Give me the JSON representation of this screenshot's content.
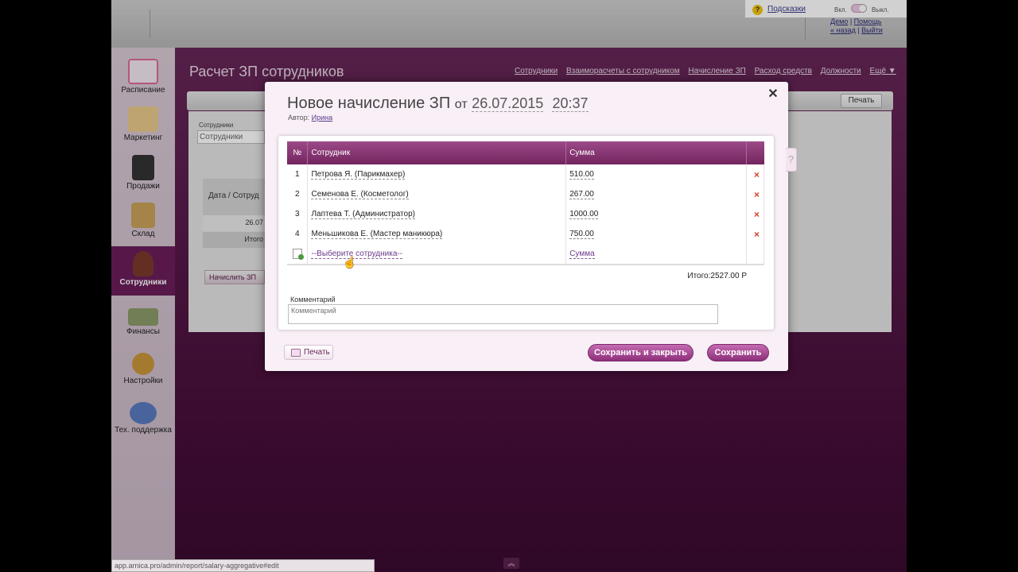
{
  "topbar": {
    "hints": {
      "label": "Подсказки",
      "on": "Вкл.",
      "off": "Выкл."
    },
    "user_links": {
      "demo": "Демо",
      "sep": "|",
      "help": "Помощь",
      "back": "« назад",
      "logout": "Выйти"
    }
  },
  "sidebar": {
    "items": [
      {
        "label": "Расписание",
        "color": "#d96a9a"
      },
      {
        "label": "Маркетинг",
        "color": "#d8a25a"
      },
      {
        "label": "Продажи",
        "color": "#4a4a4a"
      },
      {
        "label": "Склад",
        "color": "#c09a4a"
      },
      {
        "label": "Сотрудники",
        "color": "#7a3a2a"
      },
      {
        "label": "Финансы",
        "color": "#7a8a5a"
      },
      {
        "label": "Настройки",
        "color": "#b98a3a"
      },
      {
        "label": "Тех. поддержка",
        "color": "#4a6ab0"
      }
    ]
  },
  "page": {
    "title": "Расчет ЗП сотрудников",
    "nav": [
      "Сотрудники",
      "Взаиморасчеты с сотрудником",
      "Начисление ЗП",
      "Расход средств",
      "Должности",
      "Ещё ▼"
    ],
    "print": "Печать",
    "filter_label": "Сотрудники",
    "filter_value": "Сотрудники",
    "table_header": "Дата / Сотруд",
    "row_date": "26.07",
    "row_total": "Итого",
    "charge_button": "Начислить ЗП"
  },
  "modal": {
    "title": "Новое начисление ЗП",
    "from": "от",
    "date": "26.07.2015",
    "time": "20:37",
    "author_label": "Автор:",
    "author": "Ирина",
    "close": "✕",
    "help": "?",
    "columns": {
      "num": "№",
      "employee": "Сотрудник",
      "sum": "Сумма"
    },
    "rows": [
      {
        "num": "1",
        "employee": "Петрова Я. (Парикмахер)",
        "sum": "510.00",
        "delete": "×"
      },
      {
        "num": "2",
        "employee": "Семенова Е. (Косметолог)",
        "sum": "267.00",
        "delete": "×"
      },
      {
        "num": "3",
        "employee": "Лаптева Т. (Администратор)",
        "sum": "1000.00",
        "delete": "×"
      },
      {
        "num": "4",
        "employee": "Меньшикова Е. (Мастер маникюра)",
        "sum": "750.00",
        "delete": "×"
      }
    ],
    "new_row": {
      "employee_placeholder": "--Выберите сотрудника--",
      "sum_placeholder": "Сумма"
    },
    "total": "Итого:2527.00 Р",
    "comment_label": "Комментарий",
    "comment_placeholder": "Комментарий",
    "print": "Печать",
    "save_close": "Сохранить и закрыть",
    "save": "Сохранить"
  },
  "status_url": "app.arnica.pro/admin/report/salary-aggregative#edit",
  "scroll_up": "︽",
  "colors": {
    "brand": "#6b1e5a",
    "button": "#a8499a",
    "delete": "#d0402a"
  }
}
